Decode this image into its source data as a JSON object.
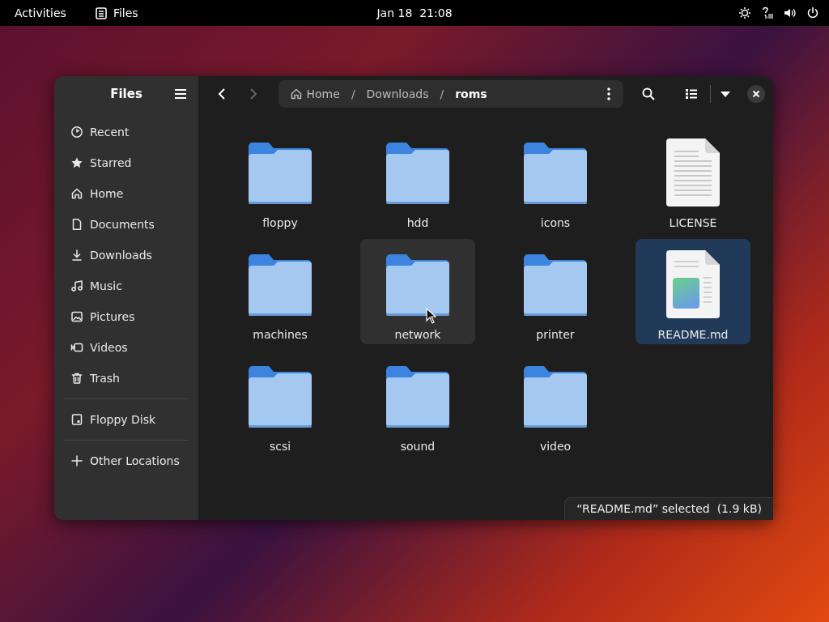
{
  "top_bar": {
    "activities": "Activities",
    "app_name": "Files",
    "clock": "Jan 18  21:08"
  },
  "sidebar": {
    "title": "Files",
    "sections": [
      {
        "items": [
          {
            "label": "Recent",
            "kind": "recent",
            "selected": false
          },
          {
            "label": "Starred",
            "kind": "starred",
            "selected": false
          },
          {
            "label": "Home",
            "kind": "home",
            "selected": false
          },
          {
            "label": "Documents",
            "kind": "documents",
            "selected": false
          },
          {
            "label": "Downloads",
            "kind": "downloads",
            "selected": false
          },
          {
            "label": "Music",
            "kind": "music",
            "selected": false
          },
          {
            "label": "Pictures",
            "kind": "pictures",
            "selected": false
          },
          {
            "label": "Videos",
            "kind": "videos",
            "selected": false
          },
          {
            "label": "Trash",
            "kind": "trash",
            "selected": false
          }
        ]
      },
      {
        "items": [
          {
            "label": "Floppy Disk",
            "kind": "drive",
            "selected": false
          }
        ]
      },
      {
        "items": [
          {
            "label": "Other Locations",
            "kind": "other",
            "selected": false
          }
        ]
      }
    ]
  },
  "path_bar": {
    "crumbs": [
      {
        "label": "Home",
        "kind": "home",
        "current": false
      },
      {
        "label": "Downloads",
        "kind": "folder",
        "current": false
      },
      {
        "label": "roms",
        "kind": "folder",
        "current": true
      }
    ],
    "separator": "/"
  },
  "files": [
    {
      "name": "floppy",
      "kind": "folder",
      "selected": false,
      "hovered": false
    },
    {
      "name": "hdd",
      "kind": "folder",
      "selected": false,
      "hovered": false
    },
    {
      "name": "icons",
      "kind": "folder",
      "selected": false,
      "hovered": false
    },
    {
      "name": "LICENSE",
      "kind": "text",
      "selected": false,
      "hovered": false
    },
    {
      "name": "machines",
      "kind": "folder",
      "selected": false,
      "hovered": false
    },
    {
      "name": "network",
      "kind": "folder",
      "selected": false,
      "hovered": true
    },
    {
      "name": "printer",
      "kind": "folder",
      "selected": false,
      "hovered": false
    },
    {
      "name": "README.md",
      "kind": "markdown",
      "selected": true,
      "hovered": false
    },
    {
      "name": "scsi",
      "kind": "folder",
      "selected": false,
      "hovered": false
    },
    {
      "name": "sound",
      "kind": "folder",
      "selected": false,
      "hovered": false
    },
    {
      "name": "video",
      "kind": "folder",
      "selected": false,
      "hovered": false
    }
  ],
  "status": "“README.md” selected  (1.9 kB)"
}
